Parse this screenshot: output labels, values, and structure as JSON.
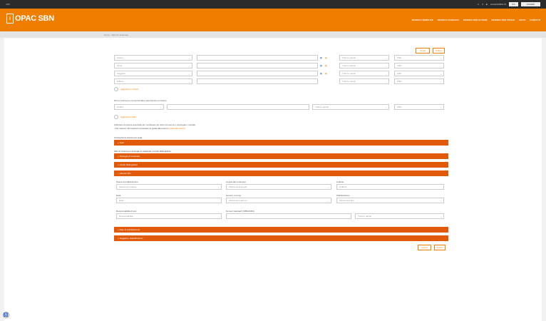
{
  "topbar": {
    "left_label": "SBN",
    "items": [
      "A",
      "A",
      "■",
      "ACCESSIBILITÀ"
    ],
    "language": "ITA",
    "login": "ACCEDI"
  },
  "header": {
    "logo_letter": "i",
    "logo_text": "OPAC SBN",
    "nav": [
      "RICERCA SEMPLICE",
      "RICERCA AVANZATA",
      "RICERCA PER AUTORE",
      "RICERCA PER TITOLO",
      "AIUTO",
      "CONTATTI"
    ]
  },
  "breadcrumb": "Home • Ricerca avanzata",
  "actions": {
    "search": "Cerca",
    "reset": "Pulisci"
  },
  "criteria_rows": [
    {
      "field": "Autore",
      "operator": "Tutte le parole",
      "connector": "AND"
    },
    {
      "field": "Titolo",
      "operator": "Tutte le parole",
      "connector": "AND"
    },
    {
      "field": "Soggetto",
      "operator": "Tutte le parole",
      "connector": "AND"
    },
    {
      "field": "Editore",
      "operator": "Tutte le parole",
      "connector": "AND"
    }
  ],
  "add_criterion": "Aggiungi un criterio",
  "numeric_hint": "Per la ricerca per numero/codice selezionare un campo",
  "numeric_row": {
    "field": "Codice",
    "operator": "Tutte le parole",
    "connector": "AND"
  },
  "add_filter": "Aggiungi un filtro",
  "notes": {
    "line1": "Utilizzare la ricerca avanzata per combinare più criteri di ricerca e restringere i risultati.",
    "line2": "Per ulteriori informazioni consultare la guida alla ricerca",
    "link": "Guida alla ricerca"
  },
  "library_label": "Circoscrivi la ricerca per sede",
  "library_bar": "Sedi",
  "material_label": "Filtri di ricerca per tipologia di materiale e livello bibliografico",
  "sections": {
    "material_type": "Tipologia di materiale",
    "bib_level": "Livello bibliografico",
    "other_filters": "Ulteriori filtri",
    "dates": "Date di pubblicazione",
    "subjects": "Soggetti e classificazioni"
  },
  "filters": [
    {
      "label": "Paese di pubblicazione",
      "placeholder": "Seleziona il paese"
    },
    {
      "label": "Lingua del contenuto",
      "placeholder": "Seleziona la lingua"
    },
    {
      "label": "Collana",
      "placeholder": "Collana"
    },
    {
      "label": "Data",
      "placeholder": "Data"
    },
    {
      "label": "Genere e forma",
      "placeholder": "Seleziona il genere"
    },
    {
      "label": "Pubblicazione",
      "placeholder": "Seleziona il tipo"
    },
    {
      "label": "Responsabilità di tesi",
      "placeholder": "Responsabilità"
    },
    {
      "label": "Numeri standard (ISBN/ISSN)",
      "placeholder": ""
    }
  ],
  "extra_field": "Tutte le parole",
  "accessibility_icon": "accessibility-icon"
}
